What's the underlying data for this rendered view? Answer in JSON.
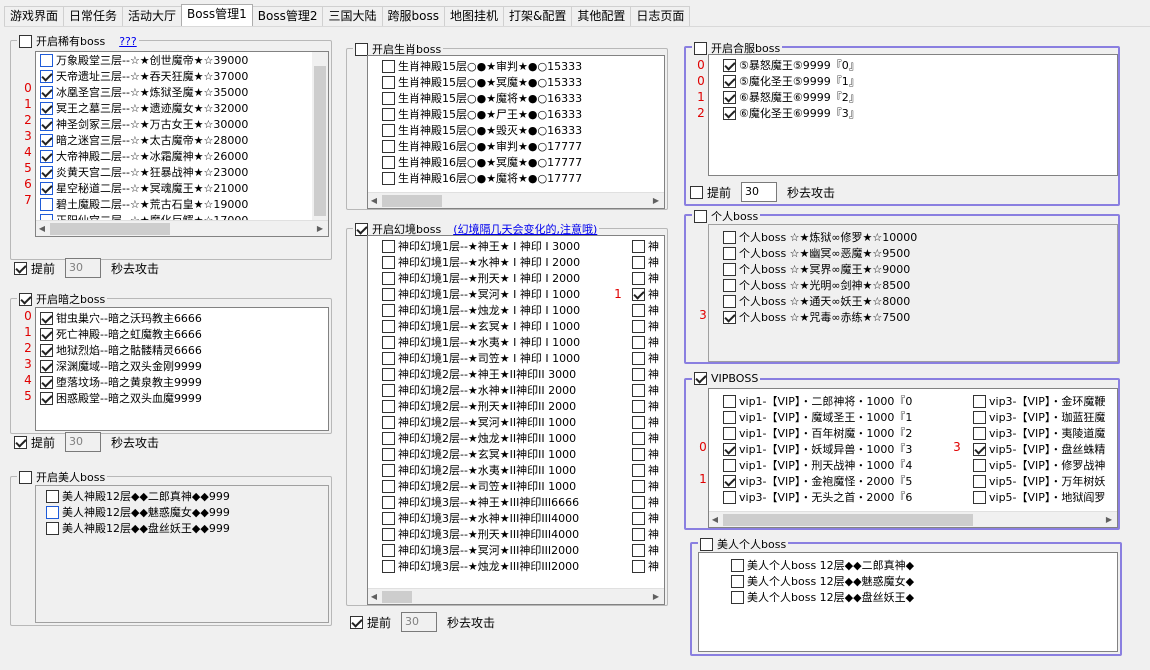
{
  "tabs": [
    "游戏界面",
    "日常任务",
    "活动大厅",
    "Boss管理1",
    "Boss管理2",
    "三国大陆",
    "跨服boss",
    "地图挂机",
    "打架&配置",
    "其他配置",
    "日志页面"
  ],
  "rare": {
    "title": "开启稀有boss",
    "link": "???",
    "items": [
      {
        "label": "万象殿堂三层--☆★创世魔帝★☆39000",
        "checked": false,
        "idx": ""
      },
      {
        "label": "天帝遗址三层--☆★吞天狂魔★☆37000",
        "checked": true,
        "idx": "0"
      },
      {
        "label": "冰凰圣宫三层--☆★炼狱圣魔★☆35000",
        "checked": true,
        "idx": "1"
      },
      {
        "label": "冥王之墓三层--☆★遗迹魔女★☆32000",
        "checked": true,
        "idx": "2"
      },
      {
        "label": "神圣剑冢三层--☆★万古女王★☆30000",
        "checked": true,
        "idx": "3"
      },
      {
        "label": "暗之迷宫三层--☆★太古魔帝★☆28000",
        "checked": true,
        "idx": "4"
      },
      {
        "label": "大帝神殿二层--☆★冰霜魔神★☆26000",
        "checked": true,
        "idx": "5"
      },
      {
        "label": "炎黄天宫二层--☆★狂暴战神★☆23000",
        "checked": true,
        "idx": "6"
      },
      {
        "label": "星空秘道二层--☆★冥魂魔王★☆21000",
        "checked": true,
        "idx": "7"
      },
      {
        "label": "碧土魔殿二层--☆★荒古石皇★☆19000",
        "checked": false,
        "idx": ""
      },
      {
        "label": "正阳仙宫二层--☆★魔化巨鳄★☆17000",
        "checked": false,
        "idx": ""
      },
      {
        "label": "晨曦王座二层--☆★万象邪王★☆14000",
        "checked": false,
        "idx": ""
      }
    ],
    "adv_label": "提前",
    "adv_value": "30",
    "adv_suffix": "秒去攻击"
  },
  "dark": {
    "title": "开启暗之boss",
    "items": [
      {
        "label": "钳虫巢穴--暗之沃玛教主6666",
        "checked": true,
        "idx": "0"
      },
      {
        "label": "死亡神殿--暗之虹魔教主6666",
        "checked": true,
        "idx": "1"
      },
      {
        "label": "地狱烈焰--暗之骷髅精灵6666",
        "checked": true,
        "idx": "2"
      },
      {
        "label": "深渊魔域--暗之双头金刚9999",
        "checked": true,
        "idx": "3"
      },
      {
        "label": "堕落坟场--暗之黄泉教主9999",
        "checked": true,
        "idx": "4"
      },
      {
        "label": "困惑殿堂--暗之双头血魔9999",
        "checked": true,
        "idx": "5"
      }
    ],
    "adv_label": "提前",
    "adv_value": "30",
    "adv_suffix": "秒去攻击"
  },
  "beauty": {
    "title": "开启美人boss",
    "items": [
      {
        "label": "美人神殿12层◆◆二郎真神◆◆999",
        "checked": false
      },
      {
        "label": "美人神殿12层◆◆魅惑魔女◆◆999",
        "checked": false,
        "blue": true
      },
      {
        "label": "美人神殿12层◆◆盘丝妖王◆◆999",
        "checked": false
      }
    ]
  },
  "zodiac": {
    "title": "开启生肖boss",
    "items": [
      "生肖神殿15层○●★审判★●○15333",
      "生肖神殿15层○●★冥魔★●○15333",
      "生肖神殿15层○●★魔将★●○16333",
      "生肖神殿15层○●★尸王★●○16333",
      "生肖神殿15层○●★毁灭★●○16333",
      "生肖神殿16层○●★审判★●○17777",
      "生肖神殿16层○●★冥魔★●○17777",
      "生肖神殿16层○●★魔将★●○17777"
    ]
  },
  "illusion": {
    "title": "开启幻境boss",
    "note": "(幻境隔几天会变化的,注意哦)",
    "items": [
      "神印幻境1层--★神王★ I 神印 I 3000",
      "神印幻境1层--★水神★ I 神印 I 2000",
      "神印幻境1层--★刑天★ I 神印 I 2000",
      "神印幻境1层--★冥河★ I 神印 I 1000",
      "神印幻境1层--★烛龙★ I 神印 I 1000",
      "神印幻境1层--★玄冥★ I 神印 I 1000",
      "神印幻境1层--★水夷★ I 神印 I 1000",
      "神印幻境1层--★司笠★ I 神印 I 1000",
      "神印幻境2层--★神王★II神印II 3000",
      "神印幻境2层--★水神★II神印II 2000",
      "神印幻境2层--★刑天★II神印II 2000",
      "神印幻境2层--★冥河★II神印II 1000",
      "神印幻境2层--★烛龙★II神印II 1000",
      "神印幻境2层--★玄冥★II神印II 1000",
      "神印幻境2层--★水夷★II神印II 1000",
      "神印幻境2层--★司笠★II神印II 1000",
      "神印幻境3层--★神王★III神印III6666",
      "神印幻境3层--★水神★III神印III4000",
      "神印幻境3层--★刑天★III神印III4000",
      "神印幻境3层--★冥河★III神印III2000",
      "神印幻境3层--★烛龙★III神印III2000"
    ],
    "col2_label": "神",
    "col2_idx": "1",
    "adv_label": "提前",
    "adv_value": "30",
    "adv_suffix": "秒去攻击"
  },
  "merge": {
    "title": "开启合服boss",
    "items": [
      {
        "label": "⑤暴怒魔王⑤9999『0』",
        "idx": "0"
      },
      {
        "label": "⑤魔化圣王⑤9999『1』",
        "idx": "0"
      },
      {
        "label": "⑥暴怒魔王⑥9999『2』",
        "idx": "1"
      },
      {
        "label": "⑥魔化圣王⑥9999『3』",
        "idx": "2"
      }
    ],
    "adv_label": "提前",
    "adv_value": "30",
    "adv_suffix": "秒去攻击"
  },
  "personal": {
    "title": "个人boss",
    "items": [
      {
        "label": "个人boss ☆★炼狱∞修罗★☆10000",
        "checked": false,
        "idx": ""
      },
      {
        "label": "个人boss ☆★幽冥∞恶魔★☆9500",
        "checked": false,
        "idx": ""
      },
      {
        "label": "个人boss ☆★冥界∞魔王★☆9000",
        "checked": false,
        "idx": ""
      },
      {
        "label": "个人boss ☆★光明∞剑神★☆8500",
        "checked": false,
        "idx": ""
      },
      {
        "label": "个人boss ☆★通天∞妖王★☆8000",
        "checked": false,
        "idx": ""
      },
      {
        "label": "个人boss ☆★咒毒∞赤练★☆7500",
        "checked": true,
        "idx": "3"
      }
    ]
  },
  "vip": {
    "title": "VIPBOSS",
    "col1": [
      {
        "label": "vip1-【VIP】・二郎神将・1000『0",
        "checked": false,
        "idx": ""
      },
      {
        "label": "vip1-【VIP】・魔域圣王・1000『1",
        "checked": false,
        "idx": ""
      },
      {
        "label": "vip1-【VIP】・百年树魔・1000『2",
        "checked": false,
        "idx": ""
      },
      {
        "label": "vip1-【VIP】・妖域异兽・1000『3",
        "checked": true,
        "idx": "0"
      },
      {
        "label": "vip1-【VIP】・刑天战神・1000『4",
        "checked": false,
        "idx": ""
      },
      {
        "label": "vip3-【VIP】・金袍魔怪・2000『5",
        "checked": true,
        "idx": "1"
      },
      {
        "label": "vip3-【VIP】・无头之首・2000『6",
        "checked": false,
        "idx": ""
      }
    ],
    "col2": [
      {
        "label": "vip3-【VIP】・金环魔鞭",
        "checked": false,
        "idx": ""
      },
      {
        "label": "vip3-【VIP】・珈蓝狂魔",
        "checked": false,
        "idx": ""
      },
      {
        "label": "vip3-【VIP】・夷陵道魔",
        "checked": false,
        "idx": ""
      },
      {
        "label": "vip5-【VIP】・盘丝蛛精",
        "checked": true,
        "idx": "3"
      },
      {
        "label": "vip5-【VIP】・修罗战神",
        "checked": false,
        "idx": ""
      },
      {
        "label": "vip5-【VIP】・万年树妖",
        "checked": false,
        "idx": ""
      },
      {
        "label": "vip5-【VIP】・地狱阎罗",
        "checked": false,
        "idx": ""
      }
    ]
  },
  "beautyPersonal": {
    "title": "美人个人boss",
    "items": [
      "美人个人boss 12层◆◆二郎真神◆",
      "美人个人boss 12层◆◆魅惑魔女◆",
      "美人个人boss 12层◆◆盘丝妖王◆"
    ]
  }
}
